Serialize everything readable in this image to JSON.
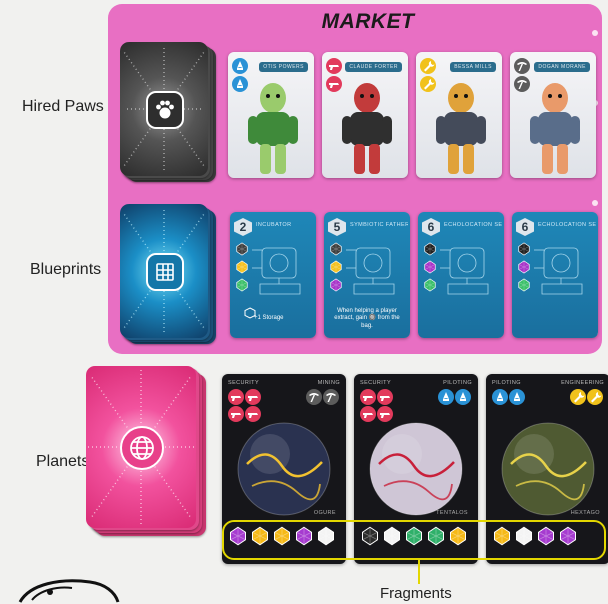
{
  "market": {
    "title": "MARKET"
  },
  "rows": {
    "hired_paws": "Hired Paws",
    "blueprints": "Blueprints",
    "planets": "Planets"
  },
  "decks": {
    "hired_paws": {
      "icon": "paw-icon"
    },
    "blueprints": {
      "icon": "blueprint-icon"
    },
    "planets": {
      "icon": "globe-icon"
    }
  },
  "hired_paw_cards": [
    {
      "name": "OTIS POWERS",
      "skills": [
        "ship-icon",
        "ship-icon"
      ],
      "color": "#2a92d6"
    },
    {
      "name": "CLAUDE FORTER",
      "skills": [
        "gun-icon",
        "gun-icon"
      ],
      "color": "#e23a5c"
    },
    {
      "name": "BESSA MILLS",
      "skills": [
        "wrench-icon",
        "wrench-icon"
      ],
      "color": "#f1c21b"
    },
    {
      "name": "DOGAN MORANE",
      "skills": [
        "pickaxe-icon",
        "pickaxe-icon"
      ],
      "color": "#5c5c5c"
    }
  ],
  "blueprint_cards": [
    {
      "cost": "2",
      "name": "INCUBATOR",
      "text": "+1 Storage",
      "gems": [
        "#3f3f3f",
        "#f6c11e",
        "#3cc06a"
      ]
    },
    {
      "cost": "5",
      "name": "SYMBIOTIC FATHER",
      "text": "When helping a player extract, gain 🔘 from the bag.",
      "gems": [
        "#3f3f3f",
        "#f6c11e",
        "#a935c9"
      ]
    },
    {
      "cost": "6",
      "name": "ECHOLOCATION SENSOR",
      "text": "",
      "gems": [
        "#222222",
        "#a935c9",
        "#3cc06a"
      ]
    },
    {
      "cost": "6",
      "name": "ECHOLOCATION SENSOR",
      "text": "",
      "gems": [
        "#222222",
        "#a935c9",
        "#3cc06a"
      ]
    }
  ],
  "planet_cards": [
    {
      "left_label": "SECURITY",
      "right_label": "MINING",
      "name": "OGURE",
      "fragments": [
        "#a63bd0",
        "#f6b917",
        "#f6b917",
        "#a63bd0",
        "#f4f4f4"
      ],
      "planet_base": "#2a3250",
      "planet_accent": "#f2c230"
    },
    {
      "left_label": "SECURITY",
      "right_label": "PILOTING",
      "name": "TENTALOS",
      "fragments": [
        "#2b2b2b",
        "#f4f4f4",
        "#2fb06a",
        "#2fb06a",
        "#f6b917"
      ],
      "planet_base": "#cfc6d6",
      "planet_accent": "#c8203a"
    },
    {
      "left_label": "PILOTING",
      "right_label": "ENGINEERING",
      "name": "HEXTAGO",
      "fragments": [
        "#f6b917",
        "#f4f4f4",
        "#a63bd0",
        "#a63bd0"
      ],
      "planet_base": "#4f5a32",
      "planet_accent": "#e7d24a"
    }
  ],
  "fragments_label": "Fragments",
  "colors": {
    "market_bg": "#e86fc3",
    "highlight": "#e3d700",
    "security": "#e23a5c",
    "piloting": "#2a92d6",
    "engineering": "#f1c21b",
    "mining": "#5c5c5c"
  }
}
